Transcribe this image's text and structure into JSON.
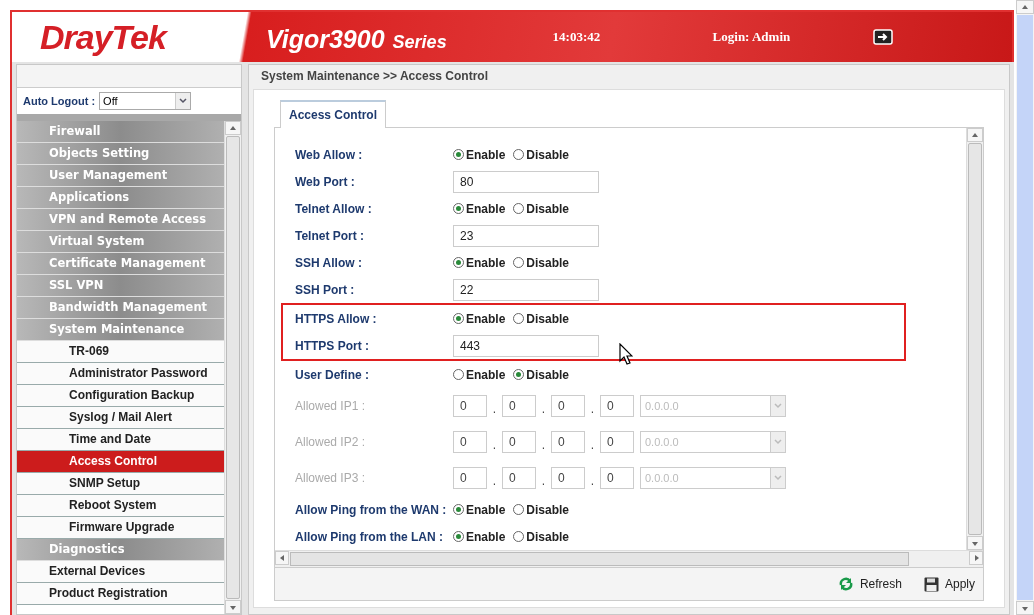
{
  "header": {
    "logo": "DrayTek",
    "model": "Vigor3900",
    "series": "Series",
    "time": "14:03:42",
    "login": "Login: Admin"
  },
  "sidebar": {
    "auto_logout": {
      "label": "Auto Logout :",
      "value": "Off"
    },
    "menu": [
      {
        "label": "Firewall",
        "kind": "group",
        "selected": false
      },
      {
        "label": "Objects Setting",
        "kind": "group",
        "selected": false
      },
      {
        "label": "User Management",
        "kind": "group",
        "selected": false
      },
      {
        "label": "Applications",
        "kind": "group",
        "selected": false
      },
      {
        "label": "VPN and Remote Access",
        "kind": "group",
        "selected": false
      },
      {
        "label": "Virtual System",
        "kind": "group",
        "selected": false
      },
      {
        "label": "Certificate Management",
        "kind": "group",
        "selected": false
      },
      {
        "label": "SSL VPN",
        "kind": "group",
        "selected": false
      },
      {
        "label": "Bandwidth Management",
        "kind": "group",
        "selected": false
      },
      {
        "label": "System Maintenance",
        "kind": "group",
        "selected": false
      },
      {
        "label": "TR-069",
        "kind": "sub",
        "selected": false
      },
      {
        "label": "Administrator Password",
        "kind": "sub",
        "selected": false
      },
      {
        "label": "Configuration Backup",
        "kind": "sub",
        "selected": false
      },
      {
        "label": "Syslog / Mail Alert",
        "kind": "sub",
        "selected": false
      },
      {
        "label": "Time and Date",
        "kind": "sub",
        "selected": false
      },
      {
        "label": "Access Control",
        "kind": "sub",
        "selected": true
      },
      {
        "label": "SNMP Setup",
        "kind": "sub",
        "selected": false
      },
      {
        "label": "Reboot System",
        "kind": "sub",
        "selected": false
      },
      {
        "label": "Firmware Upgrade",
        "kind": "sub",
        "selected": false
      },
      {
        "label": "Diagnostics",
        "kind": "group",
        "selected": false
      },
      {
        "label": "External Devices",
        "kind": "link",
        "selected": false
      },
      {
        "label": "Product Registration",
        "kind": "link",
        "selected": false
      }
    ]
  },
  "breadcrumb": "System Maintenance >> Access Control",
  "tabs": [
    {
      "label": "Access Control",
      "selected": true
    }
  ],
  "form": [
    {
      "kind": "radio",
      "label": "Web Allow :",
      "highlighted": false,
      "disabled": false,
      "options": [
        {
          "label": "Enable",
          "selected": true
        },
        {
          "label": "Disable",
          "selected": false
        }
      ]
    },
    {
      "kind": "text",
      "label": "Web Port :",
      "highlighted": false,
      "disabled": false,
      "value": "80"
    },
    {
      "kind": "radio",
      "label": "Telnet Allow :",
      "highlighted": false,
      "disabled": false,
      "options": [
        {
          "label": "Enable",
          "selected": true
        },
        {
          "label": "Disable",
          "selected": false
        }
      ]
    },
    {
      "kind": "text",
      "label": "Telnet Port :",
      "highlighted": false,
      "disabled": false,
      "value": "23"
    },
    {
      "kind": "radio",
      "label": "SSH Allow :",
      "highlighted": false,
      "disabled": false,
      "options": [
        {
          "label": "Enable",
          "selected": true
        },
        {
          "label": "Disable",
          "selected": false
        }
      ]
    },
    {
      "kind": "text",
      "label": "SSH Port :",
      "highlighted": false,
      "disabled": false,
      "value": "22"
    },
    {
      "kind": "radio",
      "label": "HTTPS Allow :",
      "highlighted": true,
      "disabled": false,
      "options": [
        {
          "label": "Enable",
          "selected": true
        },
        {
          "label": "Disable",
          "selected": false
        }
      ]
    },
    {
      "kind": "text",
      "label": "HTTPS Port :",
      "highlighted": true,
      "disabled": false,
      "value": "443"
    },
    {
      "kind": "radio",
      "label": "User Define :",
      "highlighted": false,
      "disabled": false,
      "options": [
        {
          "label": "Enable",
          "selected": false
        },
        {
          "label": "Disable",
          "selected": true
        }
      ]
    },
    {
      "kind": "ip",
      "label": "Allowed IP1 :",
      "highlighted": false,
      "disabled": true,
      "separator": ".",
      "octets": [
        "0",
        "0",
        "0",
        "0"
      ],
      "mask": "0.0.0.0"
    },
    {
      "kind": "ip",
      "label": "Allowed IP2 :",
      "highlighted": false,
      "disabled": true,
      "separator": ".",
      "octets": [
        "0",
        "0",
        "0",
        "0"
      ],
      "mask": "0.0.0.0"
    },
    {
      "kind": "ip",
      "label": "Allowed IP3 :",
      "highlighted": false,
      "disabled": true,
      "separator": ".",
      "octets": [
        "0",
        "0",
        "0",
        "0"
      ],
      "mask": "0.0.0.0"
    },
    {
      "kind": "radio",
      "label": "Allow Ping from the WAN :",
      "highlighted": false,
      "disabled": false,
      "options": [
        {
          "label": "Enable",
          "selected": true
        },
        {
          "label": "Disable",
          "selected": false
        }
      ]
    },
    {
      "kind": "radio",
      "label": "Allow Ping from the LAN :",
      "highlighted": false,
      "disabled": false,
      "options": [
        {
          "label": "Enable",
          "selected": true
        },
        {
          "label": "Disable",
          "selected": false
        }
      ]
    }
  ],
  "buttons": [
    {
      "label": "Refresh",
      "kind": "refresh"
    },
    {
      "label": "Apply",
      "kind": "apply"
    }
  ]
}
